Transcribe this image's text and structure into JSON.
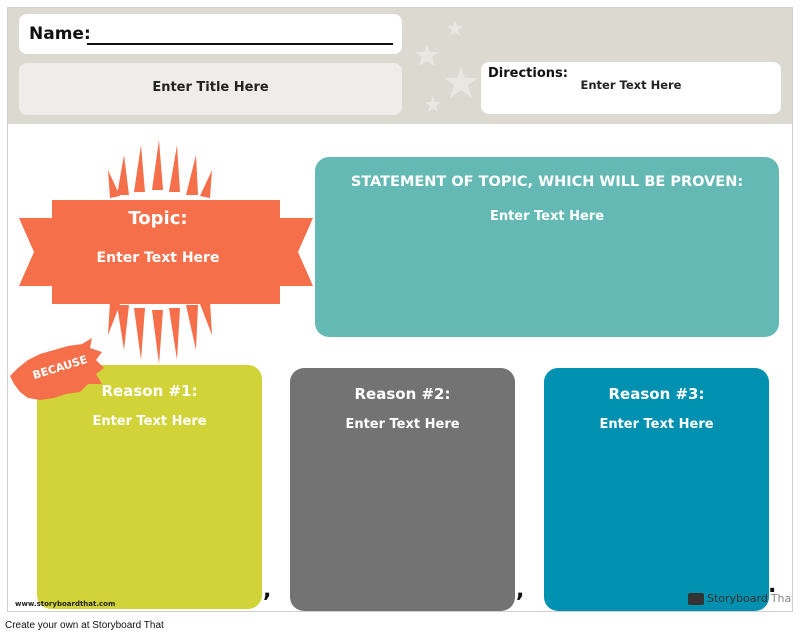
{
  "header": {
    "name_label": "Name:",
    "title_placeholder": "Enter Title Here",
    "directions_label": "Directions:",
    "directions_text": "Enter Text Here"
  },
  "topic": {
    "label": "Topic:",
    "text": "Enter Text Here",
    "color": "#f5704a"
  },
  "statement": {
    "heading": "STATEMENT OF TOPIC, WHICH WILL BE PROVEN:",
    "text": "Enter Text Here",
    "color": "#64b9b5"
  },
  "because_label": "BECAUSE",
  "reasons": [
    {
      "label": "Reason #1:",
      "text": "Enter Text Here",
      "color": "#d2d339"
    },
    {
      "label": "Reason #2:",
      "text": "Enter Text Here",
      "color": "#737373"
    },
    {
      "label": "Reason #3:",
      "text": "Enter Text Here",
      "color": "#0090b0"
    }
  ],
  "punctuation": {
    "comma": ",",
    "period": "."
  },
  "watermark": {
    "left": "www.storyboardthat.com",
    "brand": "Storyboard",
    "brand_suffix": "That"
  },
  "footer": "Create your own at Storyboard That"
}
